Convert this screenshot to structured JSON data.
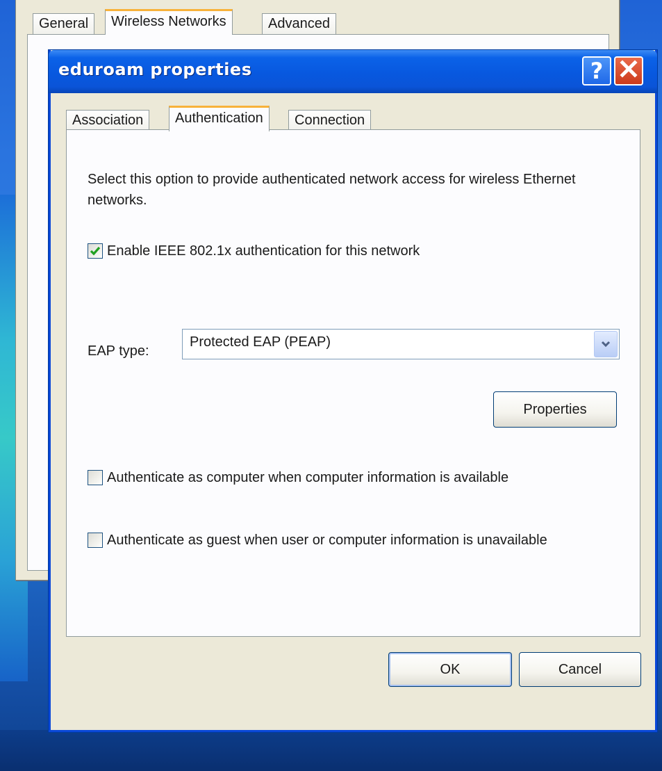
{
  "background_window": {
    "tabs": [
      {
        "label": "General",
        "active": false
      },
      {
        "label": "Wireless Networks",
        "active": true
      },
      {
        "label": "Advanced",
        "active": false
      }
    ]
  },
  "dialog": {
    "title": "eduroam properties",
    "help_button": "?",
    "close_button": "✕",
    "tabs": [
      {
        "label": "Association",
        "active": false
      },
      {
        "label": "Authentication",
        "active": true
      },
      {
        "label": "Connection",
        "active": false
      }
    ],
    "description": "Select this option to provide authenticated network access for wireless Ethernet networks.",
    "enable_8021x": {
      "label": "Enable IEEE 802.1x authentication for this network",
      "checked": true
    },
    "eap_type": {
      "label": "EAP type:",
      "value": "Protected EAP (PEAP)"
    },
    "properties_button": "Properties",
    "auth_as_computer": {
      "label": "Authenticate as computer when computer information is available",
      "checked": false
    },
    "auth_as_guest": {
      "label": "Authenticate as guest when user or computer information is unavailable",
      "checked": false
    },
    "ok_button": "OK",
    "cancel_button": "Cancel"
  },
  "colors": {
    "titlebar": "#0858df",
    "close_button": "#cc3a1c",
    "active_tab_accent": "#f8b23a",
    "checkmark": "#21a121"
  },
  "icons": {
    "help": "help-icon",
    "close": "close-icon",
    "dropdown": "chevron-down-icon",
    "check": "checkmark-icon"
  }
}
